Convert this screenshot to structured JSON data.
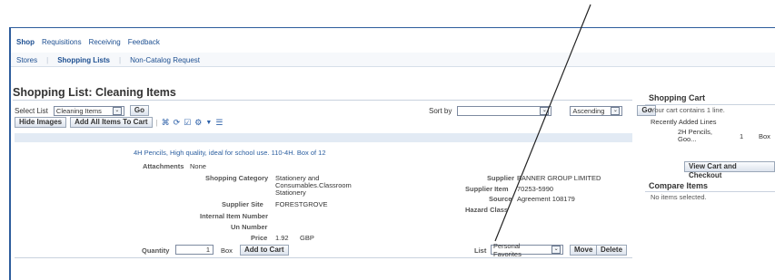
{
  "tabs": [
    "Shop",
    "Requisitions",
    "Receiving",
    "Feedback"
  ],
  "subtabs": [
    "Stores",
    "Shopping Lists",
    "Non-Catalog Request"
  ],
  "page": {
    "title": "Shopping List: Cleaning Items",
    "select_list_label": "Select List",
    "select_list_value": "Cleaning Items",
    "go_label": "Go",
    "sort_by_label": "Sort by",
    "sort_by_value": "",
    "sort_order_value": "Ascending",
    "sort_go_label": "Go",
    "hide_images_label": "Hide Images",
    "add_all_label": "Add All Items To Cart"
  },
  "item": {
    "description": "4H Pencils, High quality, ideal for school use. 110-4H. Box of 12",
    "attachments_label": "Attachments",
    "attachments_value": "None",
    "category_label": "Shopping Category",
    "category_value_1": "Stationery and",
    "category_value_2": "Consumables.Classroom",
    "category_value_3": "Stationery",
    "supplier_site_label": "Supplier Site",
    "supplier_site_value": "FORESTGROVE",
    "internal_item_label": "Internal Item Number",
    "un_number_label": "Un Number",
    "price_label": "Price",
    "price_value": "1.92",
    "currency": "GBP",
    "quantity_label": "Quantity",
    "quantity_value": "1",
    "uom": "Box",
    "add_to_cart_label": "Add to Cart",
    "supplier_label": "Supplier",
    "supplier_value": "BANNER GROUP LIMITED",
    "supplier_item_label": "Supplier Item",
    "supplier_item_value": "70253-5990",
    "source_label": "Source",
    "source_value": "Agreement 108179",
    "hazard_label": "Hazard Class",
    "list_label": "List",
    "list_value": "Personal Favorites",
    "move_label": "Move",
    "delete_label": "Delete"
  },
  "cart": {
    "title": "Shopping Cart",
    "summary": "Your cart contains 1 line.",
    "recent_label": "Recently Added Lines",
    "recent_item_1": "2H Pencils,",
    "recent_item_2": "Goo...",
    "recent_qty": "1",
    "recent_uom": "Box",
    "checkout_label": "View Cart and Checkout"
  },
  "compare": {
    "title": "Compare Items",
    "empty_text": "No items selected."
  },
  "icons": [
    "compare-icon",
    "refresh-icon",
    "select-all-icon",
    "settings-icon",
    "dropdown-icon",
    "details-icon"
  ]
}
